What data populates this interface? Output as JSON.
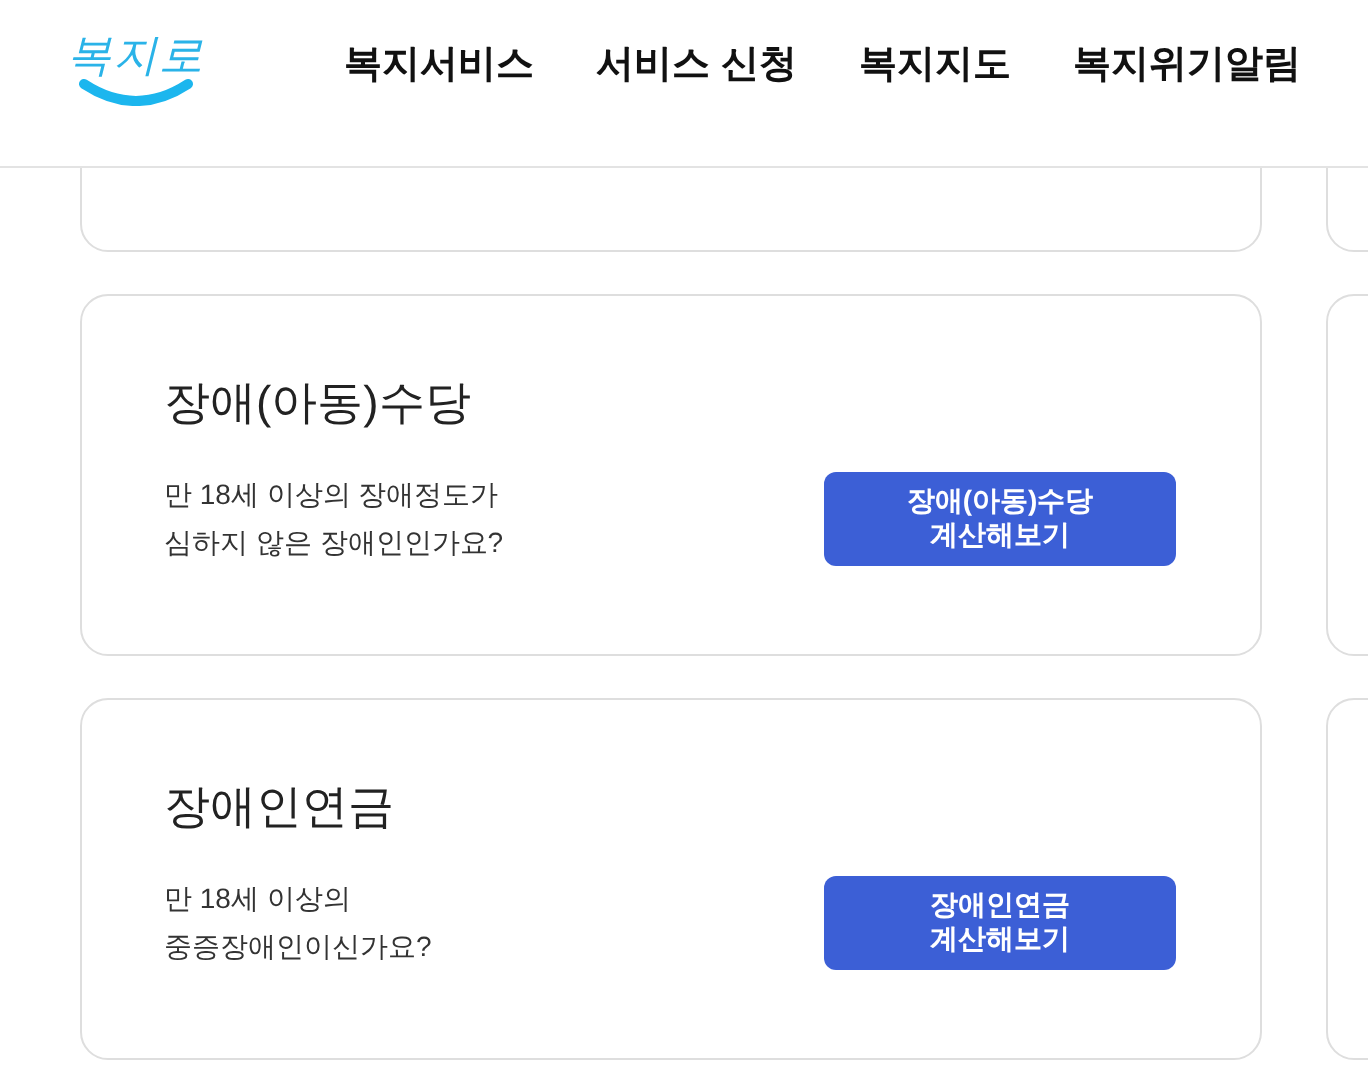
{
  "header": {
    "logo": "복지로",
    "nav": [
      {
        "label": "복지서비스"
      },
      {
        "label": "서비스 신청"
      },
      {
        "label": "복지지도"
      },
      {
        "label": "복지위기알림"
      }
    ]
  },
  "cards": [
    {
      "title": "장애(아동)수당",
      "description": "만 18세 이상의 장애정도가\n심하지 않은 장애인인가요?",
      "button": "장애(아동)수당\n계산해보기"
    },
    {
      "title": "장애인연금",
      "description": "만 18세 이상의\n중증장애인이신가요?",
      "button": "장애인연금\n계산해보기"
    }
  ]
}
